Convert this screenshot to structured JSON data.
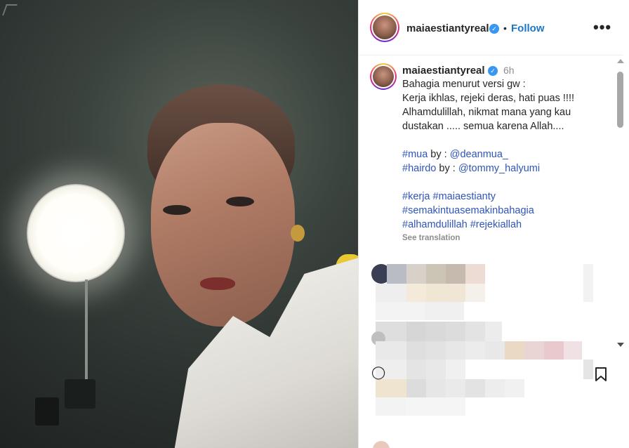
{
  "post": {
    "username": "maiaestiantyreal",
    "follow_label": "Follow",
    "separator": "•",
    "more_label": "•••",
    "verified_mark": "✓"
  },
  "caption": {
    "username": "maiaestiantyreal",
    "time": "6h",
    "lines": [
      "Bahagia menurut versi gw :",
      "Kerja ikhlas, rejeki deras, hati puas !!!!",
      "Alhamdulillah, nikmat mana yang kau",
      "dustakan ..... semua karena Allah...."
    ],
    "credits": [
      {
        "tag": "#mua",
        "by": " by : ",
        "handle": "@deanmua_"
      },
      {
        "tag": "#hairdo",
        "by": " by : ",
        "handle": "@tommy_halyumi"
      }
    ],
    "hashtags": [
      "#kerja #maiaestianty",
      "#semakintuasemakinbahagia",
      "#alhamdulillah #rejekiallah"
    ],
    "see_translation": "See translation"
  },
  "icons": {
    "more": "more-options-icon",
    "verified": "verified-badge-icon",
    "bookmark": "bookmark-icon",
    "comment": "comment-icon",
    "scroll_up": "scroll-up-icon",
    "scroll_down": "scroll-down-icon"
  },
  "colors": {
    "link": "#2f55b8",
    "follow": "#1877c9",
    "verified": "#3897f0",
    "text": "#262626",
    "muted": "#8e8e8e"
  }
}
